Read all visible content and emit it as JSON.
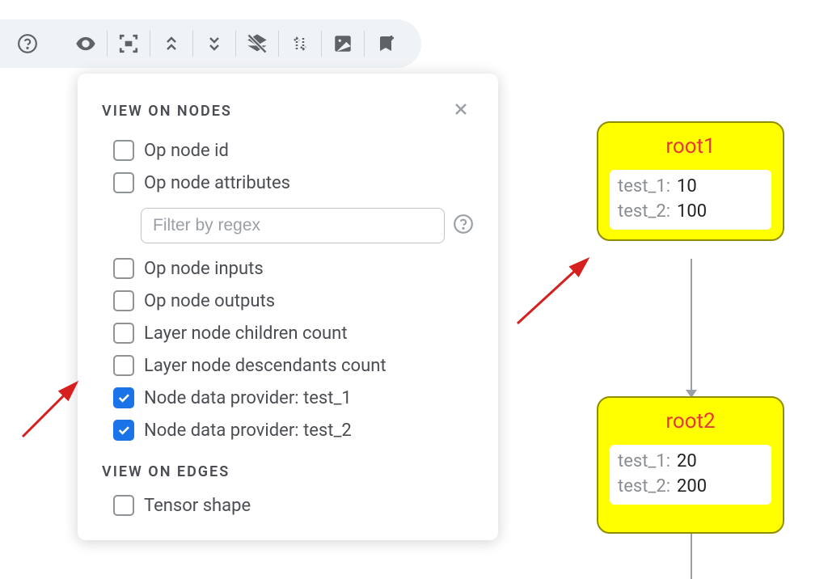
{
  "toolbar": {
    "icons": [
      "help",
      "eye",
      "fit",
      "expand-up",
      "collapse-down",
      "layers-off",
      "sort-vert",
      "image",
      "bookmark-add"
    ]
  },
  "panel": {
    "sections": {
      "nodes_title": "VIEW ON NODES",
      "edges_title": "VIEW ON EDGES"
    },
    "filter_placeholder": "Filter by regex",
    "options": [
      {
        "label": "Op node id",
        "checked": false
      },
      {
        "label": "Op node attributes",
        "checked": false
      },
      {
        "label": "Op node inputs",
        "checked": false
      },
      {
        "label": "Op node outputs",
        "checked": false
      },
      {
        "label": "Layer node children count",
        "checked": false
      },
      {
        "label": "Layer node descendants count",
        "checked": false
      },
      {
        "label": "Node data provider: test_1",
        "checked": true
      },
      {
        "label": "Node data provider: test_2",
        "checked": true
      }
    ],
    "edges_options": [
      {
        "label": "Tensor shape",
        "checked": false
      }
    ]
  },
  "graph": {
    "node1": {
      "title": "root1",
      "rows": [
        {
          "key": "test_1:",
          "val": "10"
        },
        {
          "key": "test_2:",
          "val": "100"
        }
      ]
    },
    "node2": {
      "title": "root2",
      "rows": [
        {
          "key": "test_1:",
          "val": "20"
        },
        {
          "key": "test_2:",
          "val": "200"
        }
      ]
    }
  }
}
